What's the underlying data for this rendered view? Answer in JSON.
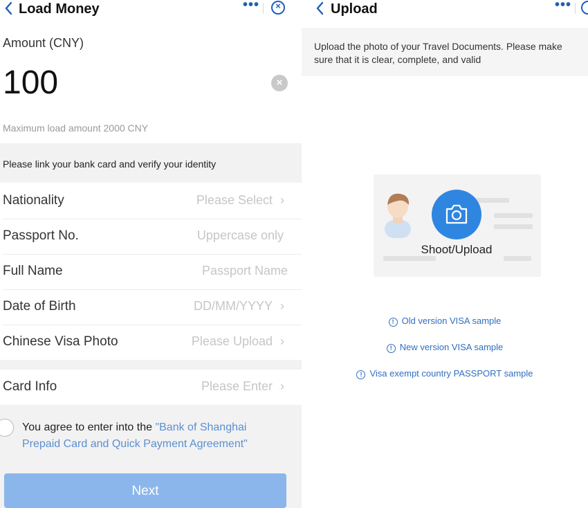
{
  "colors": {
    "accent": "#1e5fb5",
    "button": "#8bb6ec",
    "link": "#5b8fd0",
    "camera": "#2f86e0"
  },
  "left": {
    "nav": {
      "back_icon": "chevron-left-icon",
      "title": "Load Money",
      "more_icon": "more-dots-icon",
      "more_label": "•••",
      "close_icon": "close-circle-icon",
      "close_glyph": "×"
    },
    "amount": {
      "label": "Amount (CNY)",
      "value": "100",
      "clear_glyph": "×"
    },
    "max_note": "Maximum load amount 2000 CNY",
    "link_note": "Please link your bank card and verify your identity",
    "fields": [
      {
        "label": "Nationality",
        "placeholder": "Please Select",
        "chevron": "›"
      },
      {
        "label": "Passport No.",
        "placeholder": "Uppercase only"
      },
      {
        "label": "Full Name",
        "placeholder": "Passport Name"
      },
      {
        "label": "Date of Birth",
        "placeholder": "DD/MM/YYYY",
        "chevron": "›"
      },
      {
        "label": "Chinese Visa Photo",
        "placeholder": "Please Upload",
        "chevron": "›"
      }
    ],
    "card_info": {
      "label": "Card Info",
      "placeholder": "Please Enter",
      "chevron": "›"
    },
    "agreement": {
      "prefix": "You agree to enter into the ",
      "link": "\"Bank of Shanghai Prepaid Card and Quick Payment Agreement\""
    },
    "next_label": "Next"
  },
  "right": {
    "nav": {
      "back_icon": "chevron-left-icon",
      "title": "Upload",
      "more_label": "•••"
    },
    "hint": "Upload the photo of your Travel Documents. Please make sure that it is clear, complete, and valid",
    "shoot_label": "Shoot/Upload",
    "samples": [
      "Old version VISA sample",
      "New version VISA sample",
      "Visa exempt country PASSPORT sample"
    ],
    "info_glyph": "!"
  }
}
